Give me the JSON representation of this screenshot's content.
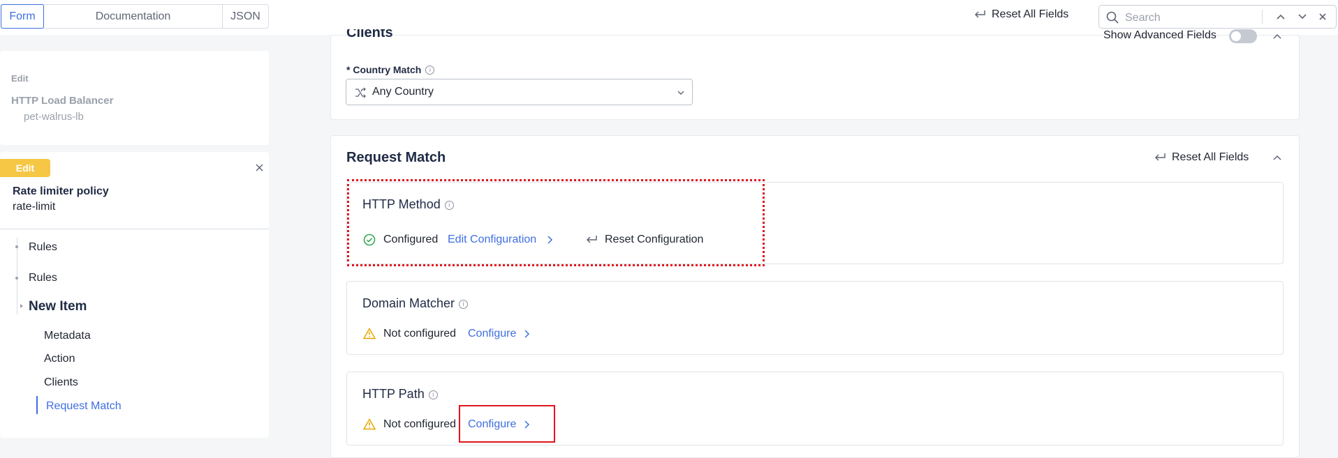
{
  "topbar": {
    "tabs": [
      {
        "label": "Form",
        "active": true
      },
      {
        "label": "Documentation",
        "active": false
      },
      {
        "label": "JSON",
        "active": false
      }
    ],
    "reset_all_label": "Reset All Fields",
    "search_placeholder": "Search"
  },
  "sidebar": {
    "parent": {
      "edit_label": "Edit",
      "type": "HTTP Load Balancer",
      "name": "pet-walrus-lb"
    },
    "current": {
      "edit_badge": "Edit",
      "type": "Rate limiter policy",
      "name": "rate-limit"
    },
    "tree": [
      {
        "label": "Rules"
      },
      {
        "label": "Rules"
      },
      {
        "label": "New Item"
      }
    ],
    "sections": [
      {
        "label": "Metadata"
      },
      {
        "label": "Action"
      },
      {
        "label": "Clients"
      },
      {
        "label": "Request Match",
        "active": true
      }
    ]
  },
  "clients": {
    "title": "Clients",
    "show_advanced_label": "Show Advanced Fields",
    "country_match_label": "* Country Match",
    "country_match_value": "Any Country"
  },
  "request_match": {
    "title": "Request Match",
    "reset_label": "Reset All Fields",
    "http_method": {
      "title": "HTTP Method",
      "status": "Configured",
      "edit_label": "Edit Configuration",
      "reset_label": "Reset Configuration"
    },
    "domain_matcher": {
      "title": "Domain Matcher",
      "status": "Not configured",
      "configure_label": "Configure"
    },
    "http_path": {
      "title": "HTTP Path",
      "status": "Not configured",
      "configure_label": "Configure"
    }
  },
  "colors": {
    "accent": "#3f6fe0",
    "warning": "#f6c744",
    "success": "#34a853",
    "highlight": "#e0141c"
  }
}
